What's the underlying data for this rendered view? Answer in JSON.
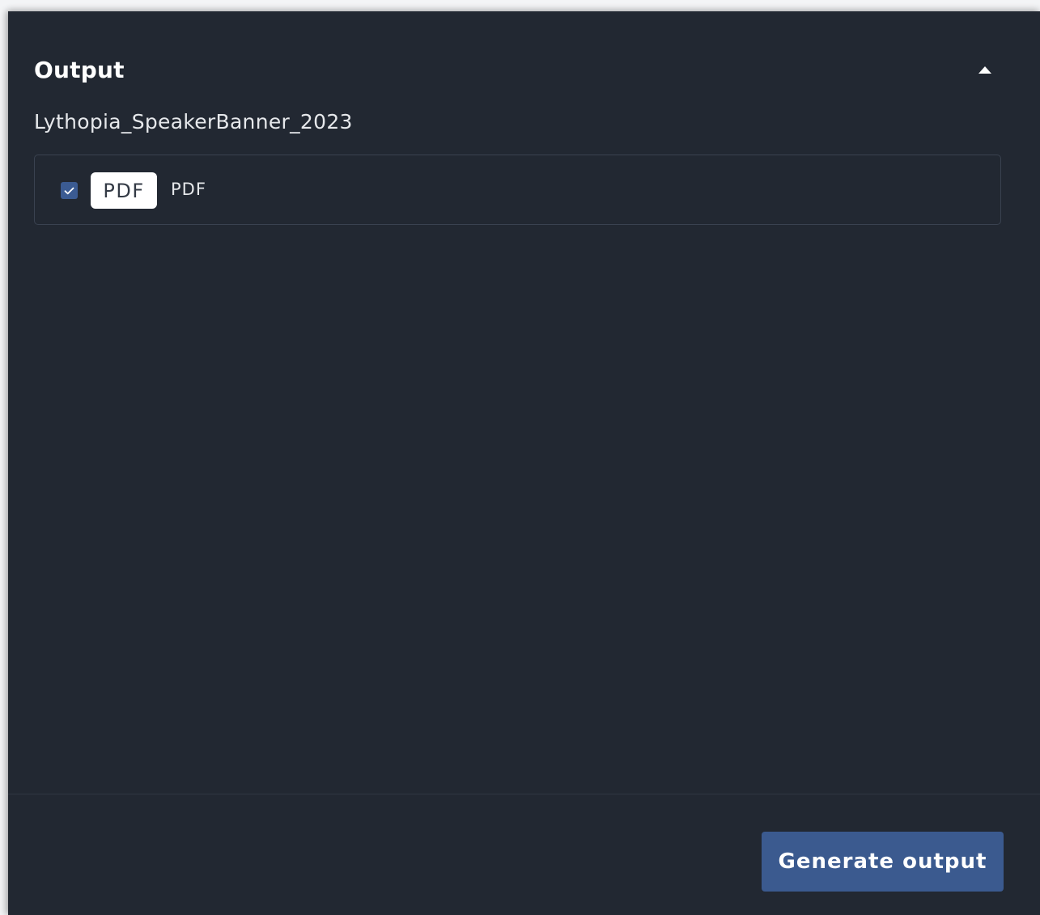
{
  "panel": {
    "title": "Output",
    "collapse_icon": "caret-up-icon",
    "filename": "Lythopia_SpeakerBanner_2023"
  },
  "formats": [
    {
      "checked": true,
      "badge": "PDF",
      "label": "PDF"
    }
  ],
  "footer": {
    "generate_label": "Generate output"
  },
  "colors": {
    "panel_bg": "#222832",
    "accent": "#3b5a8f",
    "text": "#ffffff"
  }
}
